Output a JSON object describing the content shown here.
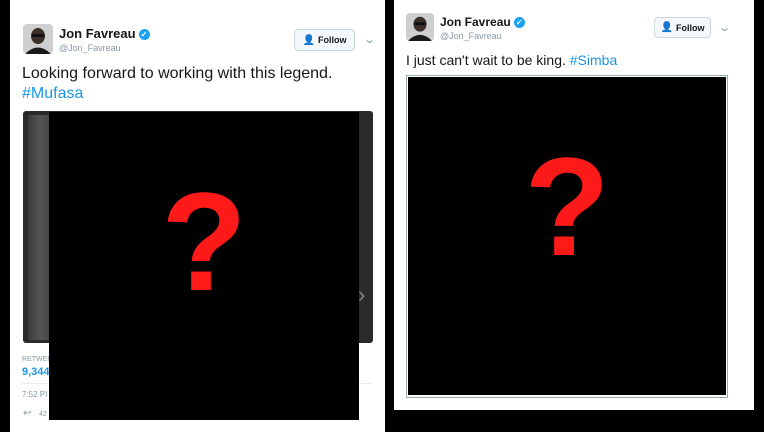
{
  "tweets": [
    {
      "author_name": "Jon Favreau",
      "handle": "@Jon_Favreau",
      "follow_label": "Follow",
      "text": "Looking forward to working with this legend.",
      "hashtag": "#Mufasa",
      "retweets_label": "RETWEE",
      "retweet_count": "9,344",
      "timestamp": "7:52 PI",
      "reply_count": "42",
      "cover_glyph": "?"
    },
    {
      "author_name": "Jon Favreau",
      "handle": "@Jon_Favreau",
      "follow_label": "Follow",
      "text": "I just can't wait to be king.",
      "hashtag": "#Simba",
      "cover_glyph": "?"
    }
  ],
  "icons": {
    "verified": "verified-badge-icon",
    "follow": "add-person-icon",
    "chevron": "chevron-down-icon",
    "reply": "reply-icon"
  },
  "colors": {
    "hashtag": "#1b95e0",
    "verified": "#1da1f2",
    "question_mark": "#ff1a1a",
    "cover": "#000000"
  }
}
